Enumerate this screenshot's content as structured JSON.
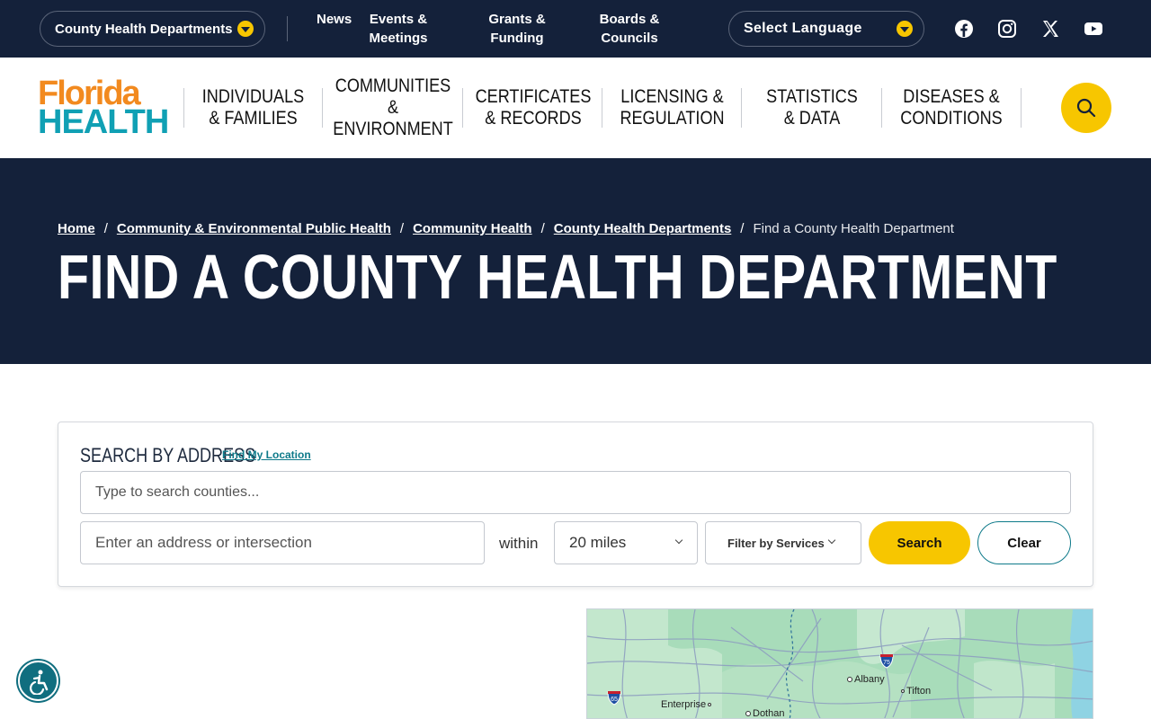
{
  "topbar": {
    "county_dropdown": "County Health Departments",
    "links": [
      "News",
      "Events & Meetings",
      "Grants & Funding",
      "Boards & Councils"
    ],
    "language": "Select Language",
    "social_icons": [
      "facebook-icon",
      "instagram-icon",
      "x-icon",
      "youtube-icon"
    ]
  },
  "logo": {
    "line1": "Florida",
    "line2": "HEALTH"
  },
  "nav": {
    "items": [
      "INDIVIDUALS & FAMILIES",
      "COMMUNITIES & ENVIRONMENT",
      "CERTIFICATES & RECORDS",
      "LICENSING & REGULATION",
      "STATISTICS & DATA",
      "DISEASES & CONDITIONS"
    ]
  },
  "hero": {
    "breadcrumb": [
      "Home",
      "Community & Environmental Public Health",
      "Community Health",
      "County Health Departments"
    ],
    "breadcrumb_current": "Find a County Health Department",
    "title": "FIND A COUNTY HEALTH DEPARTMENT"
  },
  "search": {
    "heading": "SEARCH BY ADDRESS",
    "find_location": "Find My Location",
    "county_placeholder": "Type to search counties...",
    "address_placeholder": "Enter an address or intersection",
    "within": "within",
    "distance": "20 miles",
    "filter": "Filter by Services",
    "search_button": "Search",
    "clear_button": "Clear"
  },
  "map": {
    "places": [
      "Albany",
      "Tifton",
      "Enterprise",
      "Dothan"
    ],
    "highways": [
      "75",
      "65"
    ]
  },
  "colors": {
    "navy": "#14213a",
    "yellow": "#f7c600",
    "orange": "#f28a1f",
    "teal": "#10a0b4",
    "link_teal": "#0e7a8a"
  }
}
